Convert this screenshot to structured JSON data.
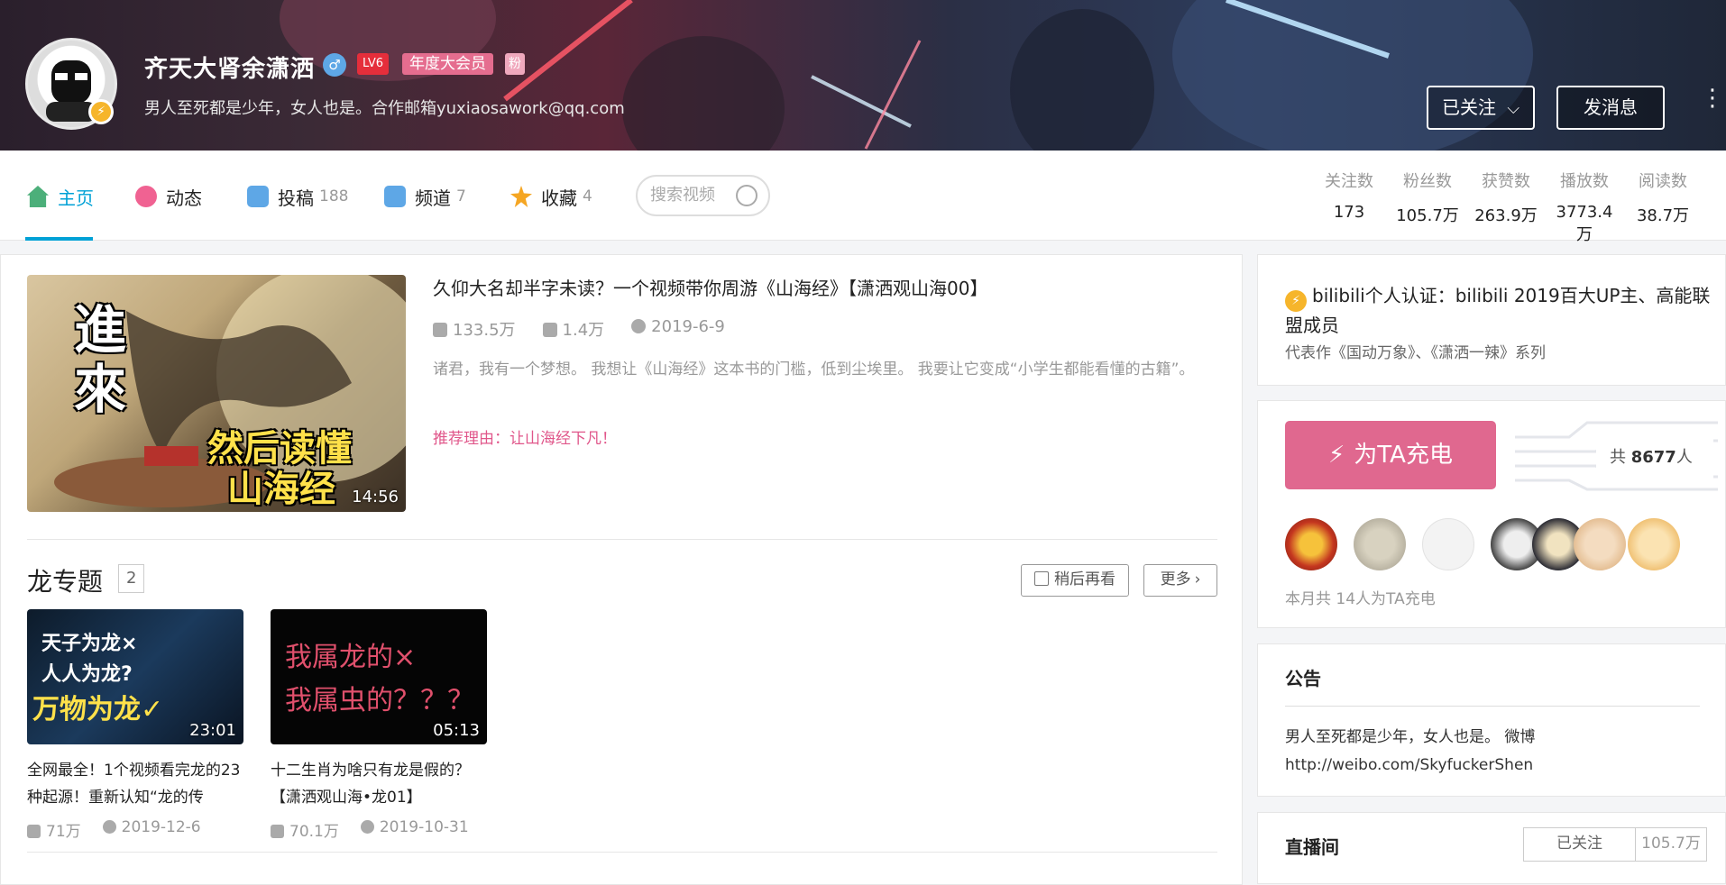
{
  "header": {
    "username": "齐天大肾余潇洒",
    "gender_icon": "male-icon",
    "level": "LV6",
    "vip_badge": "年度大会员",
    "fan_badge": "粉",
    "sign": "男人至死都是少年，女人也是。合作邮箱yuxiaosawork@qq.com",
    "follow_label": "已关注",
    "message_label": "发消息"
  },
  "nav": {
    "items": [
      {
        "label": "主页",
        "count": "",
        "icon": "home-icon",
        "color": "#4caf7a"
      },
      {
        "label": "动态",
        "count": "",
        "icon": "dynamic-icon",
        "color": "#f06292"
      },
      {
        "label": "投稿",
        "count": "188",
        "icon": "upload-icon",
        "color": "#5ea7e6"
      },
      {
        "label": "频道",
        "count": "7",
        "icon": "channel-icon",
        "color": "#5ea7e6"
      },
      {
        "label": "收藏",
        "count": "4",
        "icon": "favorite-icon",
        "color": "#f5a623"
      }
    ],
    "search_placeholder": "搜索视频",
    "stats": [
      {
        "label": "关注数",
        "value": "173"
      },
      {
        "label": "粉丝数",
        "value": "105.7万"
      },
      {
        "label": "获赞数",
        "value": "263.9万"
      },
      {
        "label": "播放数",
        "value": "3773.4万"
      },
      {
        "label": "阅读数",
        "value": "38.7万"
      }
    ]
  },
  "featured": {
    "thumb_text_1": "進",
    "thumb_text_2": "來",
    "thumb_text_3": "然后读懂",
    "thumb_text_4": "山海经",
    "duration": "14:56",
    "title": "久仰大名却半字未读？一个视频带你周游《山海经》【潇洒观山海00】",
    "plays": "133.5万",
    "danmaku": "1.4万",
    "date": "2019-6-9",
    "desc": "诸君，我有一个梦想。 我想让《山海经》这本书的门槛，低到尘埃里。 我要让它变成“小学生都能看懂的古籍”。",
    "reason": "推荐理由：让山海经下凡！"
  },
  "series": {
    "title": "龙专题",
    "count": "2",
    "watch_later": "稍后再看",
    "more": "更多",
    "videos": [
      {
        "thumb_line1": "天子为龙×",
        "thumb_line2": "人人为龙?",
        "thumb_line3": "万物为龙✓",
        "duration": "23:01",
        "title": "全网最全！1个视频看完龙的23种起源！重新认知“龙的传",
        "plays": "71万",
        "date": "2019-12-6"
      },
      {
        "thumb_line1": "我属龙的×",
        "thumb_line2": "我属虫的？？？",
        "thumb_line3": "",
        "duration": "05:13",
        "title": "十二生肖为啥只有龙是假的？【潇洒观山海•龙01】",
        "plays": "70.1万",
        "date": "2019-10-31"
      }
    ]
  },
  "cert": {
    "text": "bilibili个人认证：bilibili 2019百大UP主、高能联盟成员",
    "sub": "代表作《国动万象》、《潇洒一辣》系列"
  },
  "charge": {
    "button": "为TA充电",
    "total_prefix": "共",
    "total": "8677",
    "total_suffix": "人",
    "month_text": "本月共 14人为TA充电"
  },
  "notice": {
    "title": "公告",
    "line1": "男人至死都是少年，女人也是。 微博",
    "line2": "http://weibo.com/SkyfuckerShen"
  },
  "live": {
    "title": "直播间",
    "follow": "已关注",
    "count": "105.7万"
  }
}
